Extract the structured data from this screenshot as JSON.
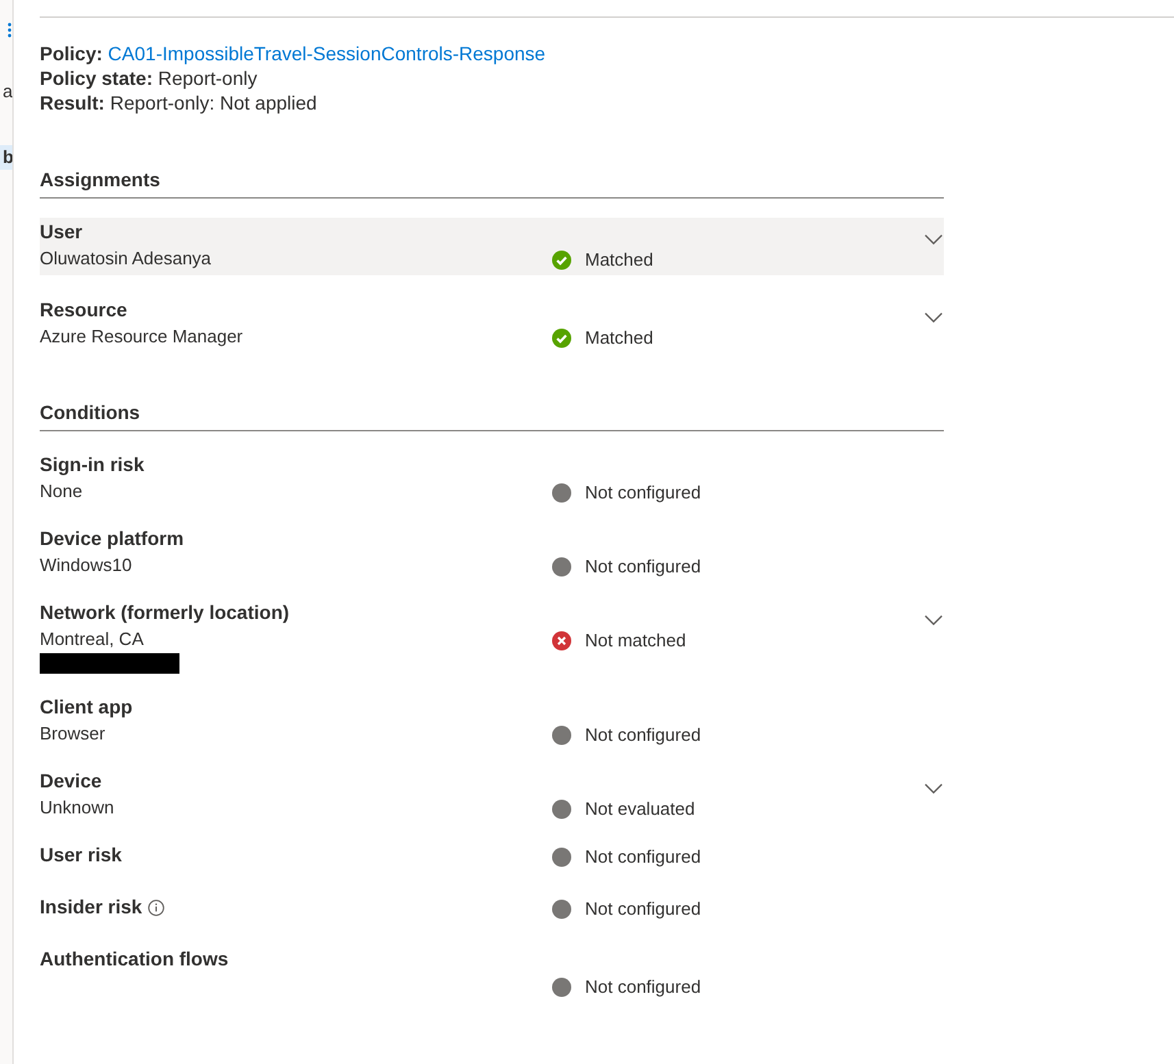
{
  "left_panel": {
    "fragments": [
      {
        "text": "a",
        "selected": false
      },
      {
        "text": "b",
        "selected": true
      }
    ]
  },
  "policy": {
    "fields": [
      {
        "label": "Policy:",
        "value": "CA01-ImpossibleTravel-SessionControls-Response",
        "kind": "link"
      },
      {
        "label": "Policy state:",
        "value": "Report-only",
        "kind": "text"
      },
      {
        "label": "Result:",
        "value": "Report-only: Not applied",
        "kind": "text"
      }
    ]
  },
  "sections": [
    {
      "title": "Assignments",
      "rows": [
        {
          "label": "User",
          "value": "Oluwatosin Adesanya",
          "status": "Matched",
          "kind": "matched",
          "expandable": true,
          "selected": true
        },
        {
          "label": "Resource",
          "value": "Azure Resource Manager",
          "status": "Matched",
          "kind": "matched",
          "expandable": true,
          "selected": false
        }
      ]
    },
    {
      "title": "Conditions",
      "rows": [
        {
          "label": "Sign-in risk",
          "value": "None",
          "status": "Not configured",
          "kind": "not_configured",
          "expandable": false,
          "selected": false
        },
        {
          "label": "Device platform",
          "value": "Windows10",
          "status": "Not configured",
          "kind": "not_configured",
          "expandable": false,
          "selected": false
        },
        {
          "label": "Network (formerly location)",
          "value": "Montreal, CA",
          "redacted": true,
          "status": "Not matched",
          "kind": "not_matched",
          "expandable": true,
          "selected": false
        },
        {
          "label": "Client app",
          "value": "Browser",
          "status": "Not configured",
          "kind": "not_configured",
          "expandable": false,
          "selected": false
        },
        {
          "label": "Device",
          "value": "Unknown",
          "status": "Not evaluated",
          "kind": "not_evaluated",
          "expandable": true,
          "selected": false
        },
        {
          "label": "User risk",
          "status": "Not configured",
          "kind": "not_configured",
          "expandable": false,
          "selected": false
        },
        {
          "label": "Insider risk",
          "info": true,
          "status": "Not configured",
          "kind": "not_configured",
          "expandable": false,
          "selected": false
        },
        {
          "label": "Authentication flows",
          "status_below": true,
          "status": "Not configured",
          "kind": "not_configured",
          "expandable": false,
          "selected": false
        }
      ]
    }
  ]
}
